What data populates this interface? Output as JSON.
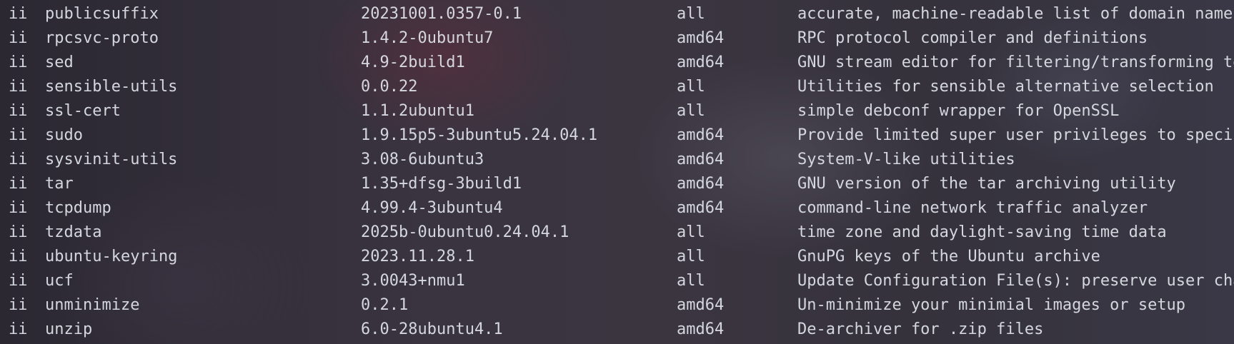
{
  "packages": [
    {
      "status": "ii",
      "name": "publicsuffix",
      "version": "20231001.0357-0.1",
      "arch": "all",
      "description": "accurate, machine-readable list of domain name"
    },
    {
      "status": "ii",
      "name": "rpcsvc-proto",
      "version": "1.4.2-0ubuntu7",
      "arch": "amd64",
      "description": "RPC protocol compiler and definitions"
    },
    {
      "status": "ii",
      "name": "sed",
      "version": "4.9-2build1",
      "arch": "amd64",
      "description": "GNU stream editor for filtering/transforming te"
    },
    {
      "status": "ii",
      "name": "sensible-utils",
      "version": "0.0.22",
      "arch": "all",
      "description": "Utilities for sensible alternative selection"
    },
    {
      "status": "ii",
      "name": "ssl-cert",
      "version": "1.1.2ubuntu1",
      "arch": "all",
      "description": "simple debconf wrapper for OpenSSL"
    },
    {
      "status": "ii",
      "name": "sudo",
      "version": "1.9.15p5-3ubuntu5.24.04.1",
      "arch": "amd64",
      "description": "Provide limited super user privileges to specif"
    },
    {
      "status": "ii",
      "name": "sysvinit-utils",
      "version": "3.08-6ubuntu3",
      "arch": "amd64",
      "description": "System-V-like utilities"
    },
    {
      "status": "ii",
      "name": "tar",
      "version": "1.35+dfsg-3build1",
      "arch": "amd64",
      "description": "GNU version of the tar archiving utility"
    },
    {
      "status": "ii",
      "name": "tcpdump",
      "version": "4.99.4-3ubuntu4",
      "arch": "amd64",
      "description": "command-line network traffic analyzer"
    },
    {
      "status": "ii",
      "name": "tzdata",
      "version": "2025b-0ubuntu0.24.04.1",
      "arch": "all",
      "description": "time zone and daylight-saving time data"
    },
    {
      "status": "ii",
      "name": "ubuntu-keyring",
      "version": "2023.11.28.1",
      "arch": "all",
      "description": "GnuPG keys of the Ubuntu archive"
    },
    {
      "status": "ii",
      "name": "ucf",
      "version": "3.0043+nmu1",
      "arch": "all",
      "description": "Update Configuration File(s): preserve user cha"
    },
    {
      "status": "ii",
      "name": "unminimize",
      "version": "0.2.1",
      "arch": "amd64",
      "description": "Un-minimize your minimial images or setup"
    },
    {
      "status": "ii",
      "name": "unzip",
      "version": "6.0-28ubuntu4.1",
      "arch": "amd64",
      "description": "De-archiver for .zip files"
    }
  ]
}
